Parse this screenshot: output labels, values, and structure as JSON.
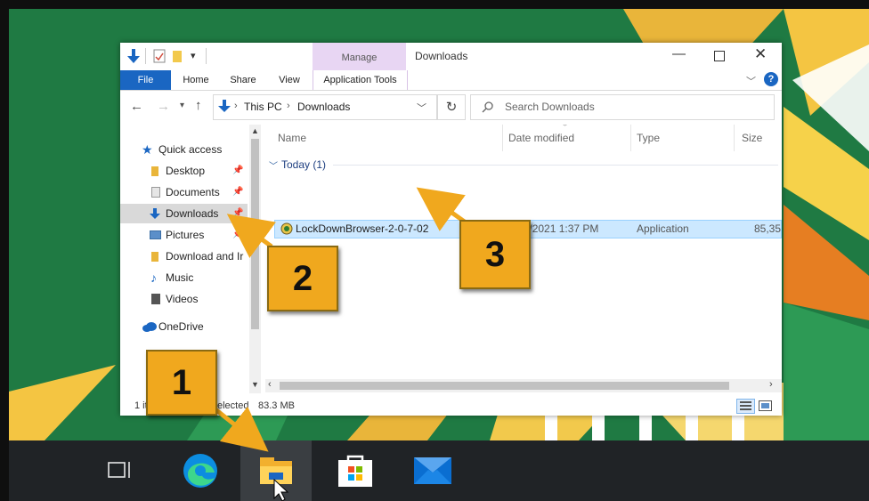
{
  "window": {
    "title": "Downloads",
    "context_tab_group": "Manage",
    "ribbon_tabs": [
      "File",
      "Home",
      "Share",
      "View",
      "Application Tools"
    ]
  },
  "address": {
    "crumbs": [
      "This PC",
      "Downloads"
    ],
    "search_placeholder": "Search Downloads"
  },
  "sidebar": {
    "items": [
      {
        "label": "Quick access",
        "icon": "star-icon"
      },
      {
        "label": "Desktop",
        "icon": "folder-icon"
      },
      {
        "label": "Documents",
        "icon": "documents-icon"
      },
      {
        "label": "Downloads",
        "icon": "download-arrow-icon"
      },
      {
        "label": "Pictures",
        "icon": "pictures-icon"
      },
      {
        "label": "Download and Ir",
        "icon": "folder-icon"
      },
      {
        "label": "Music",
        "icon": "music-note-icon"
      },
      {
        "label": "Videos",
        "icon": "videos-icon"
      },
      {
        "label": "OneDrive",
        "icon": "cloud-icon"
      }
    ]
  },
  "columns": [
    "Name",
    "Date modified",
    "Type",
    "Size"
  ],
  "group": {
    "label": "Today (1)"
  },
  "files": [
    {
      "name": "LockDownBrowser-2-0-7-02",
      "date": "4/30/2021 1:37 PM",
      "type": "Application",
      "size": "85,35"
    }
  ],
  "status": {
    "count": "1 it",
    "selected": "elected",
    "size": "83.3 MB"
  },
  "callouts": [
    "1",
    "2",
    "3"
  ],
  "taskbar": {
    "icons": [
      "task-view-icon",
      "edge-icon",
      "file-explorer-icon",
      "store-icon",
      "mail-icon"
    ]
  },
  "colors": {
    "accent": "#1a66c2",
    "selected_row": "#cce8ff",
    "callout": "#f0a81e",
    "desktop": "#1f7a43"
  }
}
